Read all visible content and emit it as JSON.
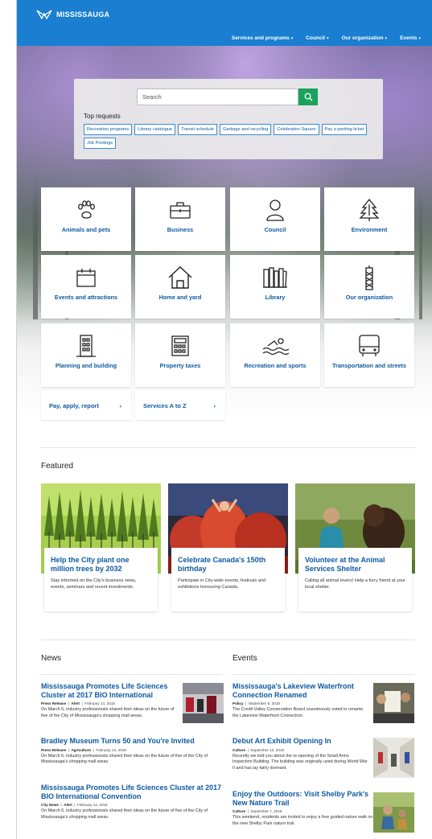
{
  "header": {
    "brand": "MISSISSAUGA",
    "nav": [
      {
        "label": "Services and programs"
      },
      {
        "label": "Council"
      },
      {
        "label": "Our organization"
      },
      {
        "label": "Events"
      }
    ]
  },
  "search": {
    "placeholder": "Search",
    "top_requests_title": "Top requests",
    "chips": [
      "Recreation programs",
      "Library catalogue",
      "Transit schedule",
      "Garbage and recycling",
      "Celebration Square",
      "Pay a parking ticket",
      "Job Postings"
    ]
  },
  "tiles": [
    {
      "label": "Animals and pets",
      "icon": "paw-icon"
    },
    {
      "label": "Business",
      "icon": "briefcase-icon"
    },
    {
      "label": "Council",
      "icon": "person-icon"
    },
    {
      "label": "Environment",
      "icon": "tree-icon"
    },
    {
      "label": "Events and attractions",
      "icon": "calendar-icon"
    },
    {
      "label": "Home and yard",
      "icon": "house-icon"
    },
    {
      "label": "Library",
      "icon": "books-icon"
    },
    {
      "label": "Our organization",
      "icon": "tower-icon"
    },
    {
      "label": "Planning and building",
      "icon": "building-icon"
    },
    {
      "label": "Property taxes",
      "icon": "calculator-icon"
    },
    {
      "label": "Recreation and sports",
      "icon": "swimmer-icon"
    },
    {
      "label": "Transportation and streets",
      "icon": "bus-icon"
    }
  ],
  "links": [
    {
      "label": "Pay, apply, report"
    },
    {
      "label": "Services A to Z"
    }
  ],
  "featured": {
    "title": "Featured",
    "cards": [
      {
        "title": "Help the City plant one million trees by 2032",
        "desc": "Stay informed on the City's business news, events, seminars and recent investments."
      },
      {
        "title": "Celebrate Canada's 150th birthday",
        "desc": "Participate in City-wide events, festivals and exhibitions honouring Canada."
      },
      {
        "title": "Volunteer at the Animal Services Shelter",
        "desc": "Calling all animal lovers! Help a furry friend at your local shelter."
      }
    ]
  },
  "news": {
    "title": "News",
    "items": [
      {
        "title": "Mississauga Promotes Life Sciences Cluster at 2017 BIO International",
        "type": "Press Release",
        "tag": "Alert",
        "date": "February 14, 2018",
        "desc": "On March 6, industry professionals shared their ideas on the future of five of the City of Mississauga's shopping mall areas."
      },
      {
        "title": "Bradley Museum Turns 50 and You're Invited",
        "type": "Press Release",
        "tag": "Agriculture",
        "date": "February 14, 2018",
        "desc": "On March 6, industry professionals shared their ideas on the future of five of the City of Mississauga's shopping mall areas."
      },
      {
        "title": "Mississauga Promotes Life Sciences Cluster at 2017 BIO International Convention",
        "type": "City News",
        "tag": "Alert",
        "date": "February 14, 2018",
        "desc": "On March 6, industry professionals shared their ideas on the future of five of the City of Mississauga's shopping mall areas."
      }
    ]
  },
  "events": {
    "title": "Events",
    "items": [
      {
        "title": "Mississauga's Lakeview Waterfront Connection Renamed",
        "type": "Policy",
        "date": "September 8, 2018",
        "desc": "The Credit Valley Conservation Board unanimously voted to rename the Lakeview Waterfront Connection."
      },
      {
        "title": "Debut Art Exhibit Opening In",
        "type": "Culture",
        "date": "September 10, 2018",
        "desc": "Recently we told you about the re-opening of the Small Arms Inspection Building. The building was originally used during World War II and has lay fairly dormant."
      },
      {
        "title": "Enjoy the Outdoors: Visit Shelby Park's New Nature Trail",
        "type": "Culture",
        "date": "September 7, 2018",
        "desc": "This weekend, residents are invited to enjoy a free guided nature walk on the new Shelby Park nature trail."
      }
    ]
  },
  "colors": {
    "brand_blue": "#1a7fd0",
    "link_blue": "#0e5aa3",
    "search_green": "#1aa25c"
  }
}
